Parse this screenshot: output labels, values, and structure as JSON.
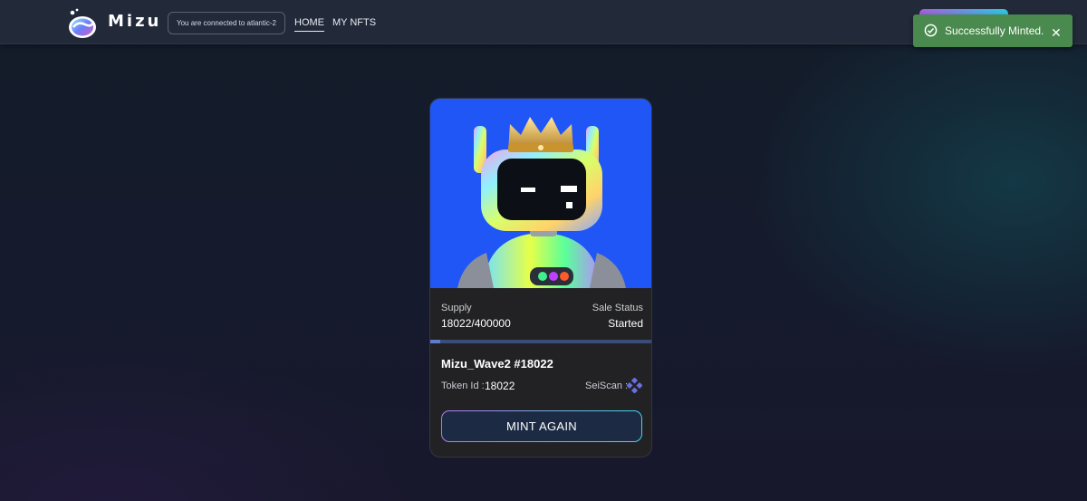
{
  "nav": {
    "brand": "Mizu",
    "connection_status": "You are connected to atlantic-2",
    "links": [
      {
        "label": "HOME",
        "active": true
      },
      {
        "label": "MY NFTS",
        "active": false
      }
    ]
  },
  "toast": {
    "message": "Successfully Minted.",
    "close_label": "✕",
    "status_color": "#4a8a4e"
  },
  "card": {
    "supply_label": "Supply",
    "supply_value": "18022/400000",
    "sale_status_label": "Sale Status",
    "sale_status_value": "Started",
    "mint_progress_fraction": 0.045,
    "nft_name": "Mizu_Wave2 #18022",
    "token_id_label": "Token Id :",
    "token_id_value": "18022",
    "seiscan_label": "SeiScan :",
    "mint_button_label": "MINT AGAIN"
  },
  "colors": {
    "accent_gradient_start": "#b07cf0",
    "accent_gradient_end": "#3fd8e8",
    "art_background": "#1f56f5"
  },
  "icons": {
    "logo": "mizu-logo-icon",
    "toast": "check-circle-icon",
    "seiscan": "seiscan-diamond-icon",
    "close": "close-icon"
  }
}
